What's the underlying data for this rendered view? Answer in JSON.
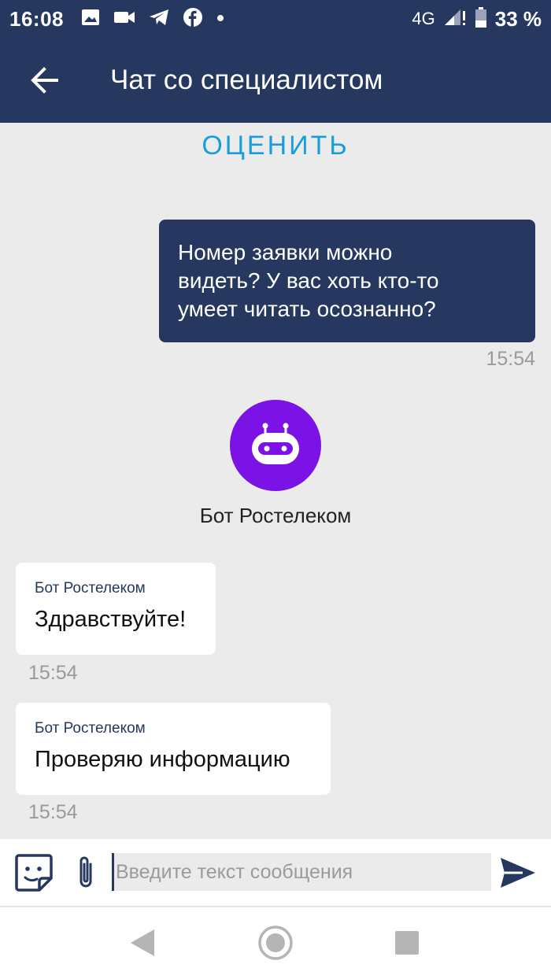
{
  "status_bar": {
    "time": "16:08",
    "network": "4G",
    "battery": "33 %",
    "icons": [
      "image-icon",
      "video-icon",
      "telegram-icon",
      "facebook-icon",
      "dot-icon",
      "signal-icon",
      "battery-icon"
    ]
  },
  "header": {
    "title": "Чат со специалистом"
  },
  "rate_label": "ОЦЕНИТЬ",
  "messages": {
    "outgoing": [
      {
        "lines": [
          "Номер заявки можно",
          "видеть? У вас хоть кто-то",
          "умеет читать осознанно?"
        ],
        "time": "15:54"
      }
    ],
    "bot_name": "Бот Ростелеком",
    "incoming": [
      {
        "sender": "Бот Ростелеком",
        "text": "Здравствуйте!",
        "time": "15:54"
      },
      {
        "sender": "Бот Ростелеком",
        "text": "Проверяю информацию",
        "time": "15:54"
      }
    ]
  },
  "composer": {
    "placeholder": "Введите текст сообщения",
    "value": ""
  },
  "colors": {
    "header_bg": "#263760",
    "accent": "#1a9ed9",
    "bot_avatar": "#7b13e6",
    "background": "#ebebeb"
  }
}
